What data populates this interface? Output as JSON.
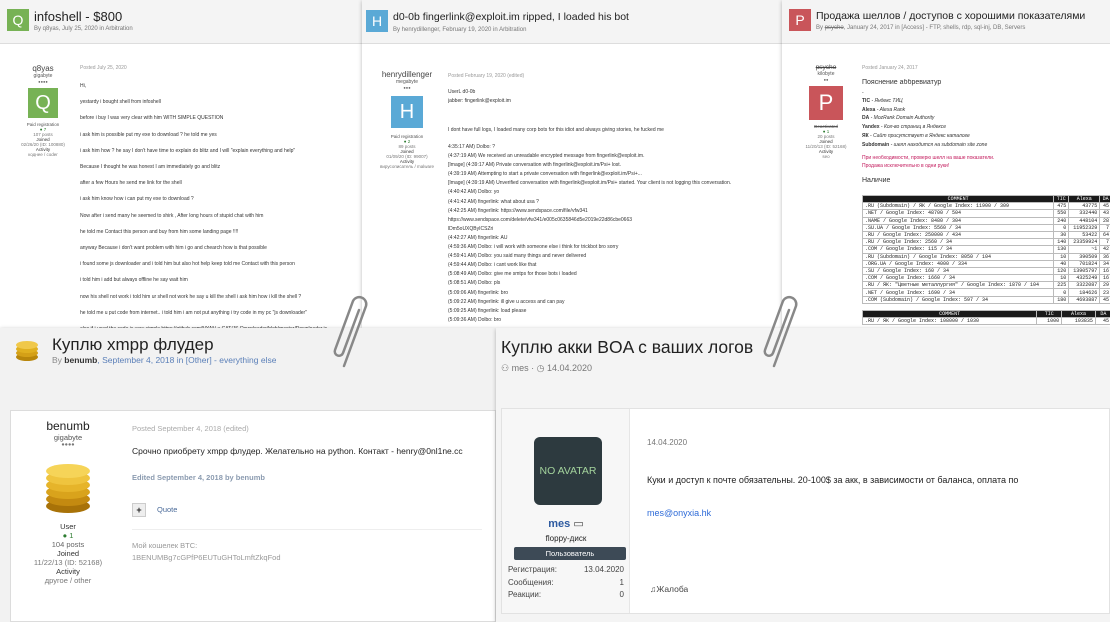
{
  "colors": {
    "green": "#77b255",
    "blue": "#5aa9d6",
    "red": "#c9555a",
    "purple": "#6a2a9c",
    "link": "#3a5a99",
    "badge": "#3d4a56",
    "accent": "#2e6bd8"
  },
  "p1": {
    "avatar_letter": "Q",
    "title": "infoshell - $800",
    "subtitle": "By q8yas, July 25, 2020 in Arbitration",
    "user": "q8yas",
    "rank": "gigabyte",
    "dots": "●●●●",
    "group": "Paid registration",
    "rep": "7",
    "posts": "107 posts",
    "joined": "Joined",
    "joined_date": "02/26/20 (ID: 100880)",
    "activity": "Activity",
    "activity_val": "коднее / coder",
    "posted": "Posted July 25, 2020",
    "lines": [
      "Hi,",
      "yestardy i bought shell from infoshell",
      "before i buy I was very clear with him WITH SIMPLE QUESTION",
      "i ask him is possible put my exe to download ? he told me yes",
      "i ask him how ? he say I don't have time to explain do blitz and I will \"explain everything and help\"",
      "Because I thought he was honest I am immediately go and blitz",
      "after a few Hours he send me link for the shell",
      "i ask him know how i can put my exe to download ?",
      "Now after i send many he seemed to shirk , After long hours of stupid chat with him",
      "he told me Contact this person and buy from him some landing page !!!!",
      "anyway Because i don't want problem with him i go and chearch how is that possible",
      "i found some js downloader and i told him but also hot help keep told me Contact with this person",
      "i told him i add but always offline he say wait him",
      "now his shell not work i told him ur shell not work he say u kill the shell i ask him how i kill the shell ?",
      "he told me u put code from internet.. i told him i am not put anything i try code in my pc \"js downloader\"",
      "also if i used the code is very simple https://github.com/NYAN-x-CAT/JS-Downloader/blob/master/Downloader.js"
    ]
  },
  "p2": {
    "avatar_letter": "H",
    "title": "d0-0b fingerlink@exploit.im ripped, I loaded his bot",
    "subtitle": "By henrydillenger, February 19, 2020 in Arbitration",
    "user": "henrydillenger",
    "rank": "megabyte",
    "dots": "●●●",
    "group": "Paid registration",
    "rep": "2",
    "posts": "89 posts",
    "joined": "Joined",
    "joined_date": "01/09/20 (ID: 99007)",
    "activity": "Activity",
    "activity_val": "вирусописатель / malware",
    "posted": "Posted February 19, 2020 (edited)",
    "intro": [
      "UserL d0-0b",
      "jabber: fingerlink@exploit.im"
    ],
    "para": "I dont have full logs, I loaded many corp bots for this idiot and always giving stories, he fucked me",
    "lines": [
      "4:35:17 AM) Dolbo: ?",
      "(4:37:19 AM) We received an unreadable encrypted message from fingerlink@exploit.im.",
      "[Image] (4:39:17 AM) Private conversation with fingerlink@exploit.im/Psi+ lost.",
      "(4:39:19 AM) Attempting to start a private conversation with fingerlink@exploit.im/Psi+...",
      "[Image] (4:39:19 AM) Unverified conversation with fingerlink@exploit.im/Psi+ started.  Your client is not logging this conversation.",
      "(4:40:42 AM) Dolbo: yo",
      "(4:41:42 AM) fingerlink: what about usa ?",
      "(4:42:25 AM) fingerlink: https://www.sendspace.com/file/vfw341",
      "https://www.sendspace.com/delete/vfw341/e005c0635846d5e2019e22d86cbe0663",
      "lDm5oUXQByICSZri",
      "(4:42:27 AM) fingerlink: AU",
      "(4:59:36 AM) Dolbo: i will work with someone else i think for trickbot bro sorry",
      "(4:59:41 AM) Dolbo: you said many things and never delivered",
      "(4:59:44 AM) Dolbo: i cant work like that",
      "(5:08:49 AM) Dolbo: give me smtps for those bots i loaded",
      "(5:08:51 AM) Dolbo: pls",
      "(5:09:06 AM) fingerlink: bro",
      "(5:09:22 AM) fingerlink: ill give u access and can pay",
      "(5:09:25 AM) fingerlink: load please",
      "(5:09:36 AM) Dolbo: bro"
    ]
  },
  "p3": {
    "avatar_letter": "P",
    "title": "Продажа шеллов / доступов с хорошими показателями",
    "subtitle_by": "By",
    "subtitle_user": "psycho",
    "subtitle_rest": ", January 24, 2017 in [Access] - FTP, shells, rdp, sql-inj, DB, Servers",
    "user": "psycho",
    "rank": "kilobyte",
    "dots": "●●",
    "group": "Deactivated",
    "rep": "1",
    "posts": "20 posts",
    "joined": "Joined",
    "joined_date": "11/20/13 (ID: 52168)",
    "activity": "Activity",
    "activity_val": "seo",
    "posted": "Posted January 24, 2017",
    "section1": "Пояснение аббревиатур",
    "dash": "-",
    "abbrev": [
      {
        "k": "TIC",
        "v": " - Яндекс ТИЦ"
      },
      {
        "k": "Alexa",
        "v": " - Alexa Rank"
      },
      {
        "k": "DA",
        "v": " - MozRank Domain Authority"
      },
      {
        "k": "Yandex",
        "v": " - Кол-во страниц в Яндексе"
      },
      {
        "k": "ЯК",
        "v": " - Сайт присутствует в Яндекс каталоге"
      },
      {
        "k": "Subdomain",
        "v": " - шелл находится на subdomain site zone"
      }
    ],
    "red1": "При необходимости, проверю шелл на ваше показатели.",
    "red2": "Продажа исключительно в одни руки!",
    "section2": "Наличие",
    "table1_head": [
      "COMMENT",
      "TIC",
      "Alexa",
      "DA"
    ],
    "table1": [
      [
        ".RU (Subdomain) / ЯК / Google Index: 11900 / 309",
        "475",
        "43775",
        "45"
      ],
      [
        ".NET / Google Index: 48700 / 504",
        "550",
        "332440",
        "43"
      ],
      [
        ".NAME / Google Index: 8480 / 304",
        "240",
        "448104",
        "28"
      ],
      [
        ".SU.UA / Google Index: 5560 / 34",
        "0",
        "11952329",
        "7"
      ],
      [
        ".RU / Google Index: 250000 / 434",
        "30",
        "53422",
        "64"
      ],
      [
        ".RU / Google Index: 2560 / 34",
        "140",
        "23359924",
        "7"
      ],
      [
        ".COM / Google Index: 115 / 34",
        "130",
        "~1",
        "42"
      ],
      [
        ".RU (Subdomain) / Google Index: 8050 / 104",
        "10",
        "390509",
        "36"
      ],
      [
        ".ORG.UA / Google Index: 4000 / 334",
        "40",
        "701824",
        "34"
      ],
      [
        ".SU / Google Index: 160 / 34",
        "120",
        "13905797",
        "16"
      ],
      [
        ".COM / Google Index: 1660 / 34",
        "10",
        "4325249",
        "16"
      ],
      [
        ".RU / ЯК: \"Цветные металлургия\" / Google Index: 1870 / 104",
        "225",
        "3322087",
        "29"
      ],
      [
        ".NET / Google Index: 1690 / 34",
        "0",
        "184626",
        "23"
      ],
      [
        ".COM (Subdomain) / Google Index: 597 / 34",
        "180",
        "4693887",
        "45"
      ]
    ],
    "table2_head": [
      "COMMENT",
      "TIC",
      "Alexa",
      "DA"
    ],
    "table2": [
      [
        ".RU / ЯК / Google Index: 108000 / 1030",
        "1000",
        "103835",
        "45"
      ]
    ]
  },
  "p4": {
    "title": "Куплю xmpp флудер",
    "sub_by": "By ",
    "sub_user": "benumb",
    "sub_date": ", September 4, 2018 in ",
    "sub_cat": "[Other] - everything else",
    "user": "benumb",
    "rank": "gigabyte",
    "dots": "●●●●",
    "group": "User",
    "rep": "1",
    "posts": "104 posts",
    "joined": "Joined",
    "joined_date": "11/22/13 (ID: 52168)",
    "activity": "Activity",
    "activity_val": "другое / other",
    "posted": "Posted September 4, 2018 (edited)",
    "body": "Срочно приобрету xmpp флудер. Желательно на python. Контакт - henry@0nl1ne.cc",
    "edited": "Edited September 4, 2018 by benumb",
    "quote_plus": "+",
    "quote": "Quote",
    "wallet_label": "Мой кошелек BTC:",
    "wallet": "1BENUMBg7cGPfP6EUTuGHToLmftZkqFod"
  },
  "p5": {
    "title": "Куплю акки BOA с ваших логов",
    "user_meta": "mes",
    "date_meta": "14.04.2020",
    "avatar_text": "NO AVATAR",
    "user": "mes",
    "rank": "floppy-диск",
    "badge": "Пользователь",
    "stats": [
      {
        "k": "Регистрация:",
        "v": "13.04.2020"
      },
      {
        "k": "Сообщения:",
        "v": "1"
      },
      {
        "k": "Реакции:",
        "v": "0"
      }
    ],
    "post_date": "14.04.2020",
    "body": "Куки и доступ к почте обязательны. 20-100$ за акк, в зависимости от баланса, оплата по",
    "email": "mes@onyxia.hk",
    "report": "Жалоба"
  }
}
